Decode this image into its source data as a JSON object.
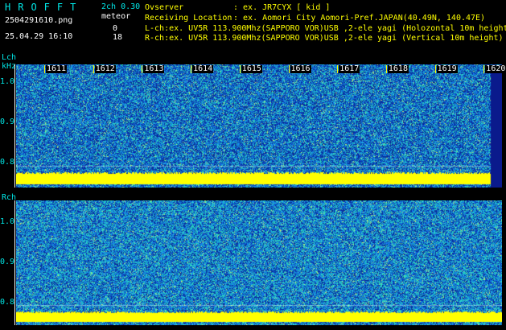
{
  "header": {
    "app_title": "HROFFT",
    "mode": "2ch 0.30",
    "filename": "2504291610.png",
    "meteor_label": "meteor",
    "datetime": "25.04.29 16:10",
    "meteor_count_l": "0",
    "meteor_count_r": "18",
    "observer_label": "Ovserver",
    "observer_value": ": ex. JR7CYX [ kid ]",
    "location_label": "Receiving Location",
    "location_value": ": ex. Aomori City Aomori-Pref.JAPAN(40.49N, 140.47E)",
    "lch_info": "L-ch:ex. UV5R 113.900Mhz(SAPPORO VOR)USB ,2-ele yagi (Holozontal 10m height",
    "rch_info": "R-ch:ex. UV5R 113.900Mhz(SAPPORO VOR)USB ,2-ele yagi (Vertical 10m height)"
  },
  "lch_panel": {
    "channel_label": "Lch",
    "unit_label": "kHz",
    "y_ticks": [
      "1.0",
      "0.9",
      "0.8"
    ],
    "time_labels": [
      "1611",
      "1612",
      "1613",
      "1614",
      "1615",
      "1616",
      "1617",
      "1618",
      "1619",
      "1620"
    ]
  },
  "rch_panel": {
    "channel_label": "Rch",
    "y_ticks": [
      "1.0",
      "0.9",
      "0.8"
    ]
  },
  "colors": {
    "background": "#000000",
    "text_cyan": "#00e6e6",
    "marker_yellow": "#ffff00",
    "spectrogram_dark": "#0a1a8c",
    "spectrogram_mid": "#1e6ed2",
    "spectrogram_hi": "#28d2b4",
    "carrier_band": "#ffff00"
  }
}
